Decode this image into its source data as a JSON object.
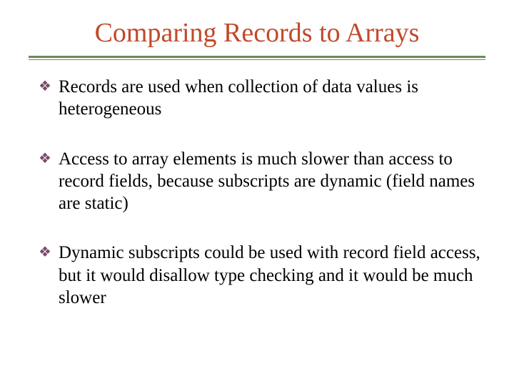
{
  "title": "Comparing Records to Arrays",
  "bullets": [
    "Records are used when collection of data values is heterogeneous",
    "Access to array elements is much slower than access to record fields, because subscripts are dynamic (field names are static)",
    "Dynamic subscripts could be used with record field access, but it would disallow type checking and it would be much slower"
  ]
}
